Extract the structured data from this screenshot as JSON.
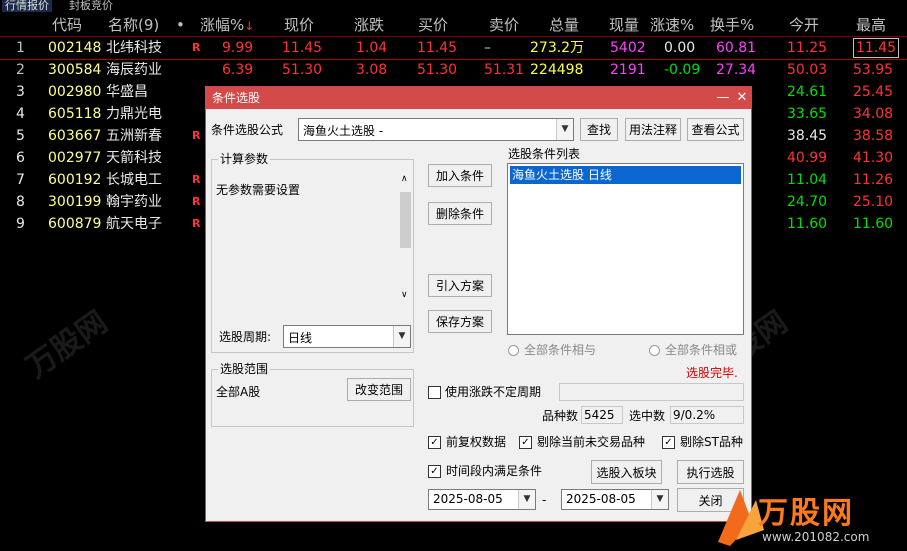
{
  "tabs": [
    "行情报价",
    "封板竞价"
  ],
  "headers": {
    "idx": "",
    "code": "代码",
    "name": "名称(9)",
    "dot": "•",
    "pct": "涨幅%",
    "sort": "↓",
    "price": "现价",
    "chg": "涨跌",
    "bid": "买价",
    "ask": "卖价",
    "vol": "总量",
    "cur": "现量",
    "speed": "涨速%",
    "turn": "换手%",
    "open": "今开",
    "high": "最高"
  },
  "rows": [
    {
      "idx": "1",
      "code": "002148",
      "name": "北纬科技",
      "mark": "R",
      "pct": "9.99",
      "price": "11.45",
      "chg": "1.04",
      "bid": "11.45",
      "ask": "–",
      "vol": "273.2万",
      "cur": "5402",
      "speed": "0.00",
      "turn": "60.81",
      "open": "11.25",
      "high": "11.45"
    },
    {
      "idx": "2",
      "code": "300584",
      "name": "海辰药业",
      "mark": "",
      "pct": "6.39",
      "price": "51.30",
      "chg": "3.08",
      "bid": "51.30",
      "ask": "51.31",
      "vol": "224498",
      "cur": "2191",
      "speed": "-0.09",
      "turn": "27.34",
      "open": "50.03",
      "high": "53.95"
    },
    {
      "idx": "3",
      "code": "002980",
      "name": "华盛昌",
      "mark": "",
      "pct": "",
      "price": "",
      "chg": "",
      "bid": "",
      "ask": "",
      "vol": "",
      "cur": "",
      "speed": "",
      "turn": "",
      "open": "24.61",
      "high": "25.45"
    },
    {
      "idx": "4",
      "code": "605118",
      "name": "力鼎光电",
      "mark": "",
      "pct": "",
      "price": "",
      "chg": "",
      "bid": "",
      "ask": "",
      "vol": "",
      "cur": "",
      "speed": "",
      "turn": "",
      "open": "33.65",
      "high": "34.08"
    },
    {
      "idx": "5",
      "code": "603667",
      "name": "五洲新春",
      "mark": "R",
      "pct": "",
      "price": "",
      "chg": "",
      "bid": "",
      "ask": "",
      "vol": "",
      "cur": "",
      "speed": "",
      "turn": "",
      "open": "38.45",
      "high": "38.58"
    },
    {
      "idx": "6",
      "code": "002977",
      "name": "天箭科技",
      "mark": "",
      "pct": "",
      "price": "",
      "chg": "",
      "bid": "",
      "ask": "",
      "vol": "",
      "cur": "",
      "speed": "",
      "turn": "",
      "open": "40.99",
      "high": "41.30"
    },
    {
      "idx": "7",
      "code": "600192",
      "name": "长城电工",
      "mark": "R",
      "pct": "",
      "price": "",
      "chg": "",
      "bid": "",
      "ask": "",
      "vol": "",
      "cur": "",
      "speed": "",
      "turn": "",
      "open": "11.04",
      "high": "11.26"
    },
    {
      "idx": "8",
      "code": "300199",
      "name": "翰宇药业",
      "mark": "R",
      "pct": "",
      "price": "",
      "chg": "",
      "bid": "",
      "ask": "",
      "vol": "",
      "cur": "",
      "speed": "",
      "turn": "",
      "open": "24.70",
      "high": "25.10"
    },
    {
      "idx": "9",
      "code": "600879",
      "name": "航天电子",
      "mark": "R",
      "pct": "",
      "price": "",
      "chg": "",
      "bid": "",
      "ask": "",
      "vol": "",
      "cur": "",
      "speed": "",
      "turn": "",
      "open": "11.60",
      "high": "11.60"
    }
  ],
  "row_colors": [
    {
      "idx": "#c0c0c0",
      "pct": "#ff3232",
      "price": "#ff3232",
      "chg": "#ff3232",
      "bid": "#ff3232",
      "ask": "#c0c0c0",
      "vol": "#ffff40",
      "cur": "#ff40ff",
      "speed": "#e8e8e8",
      "turn": "#ff40ff",
      "open": "#ff3232",
      "high": "#ff3232"
    },
    {
      "idx": "#c0c0c0",
      "pct": "#ff3232",
      "price": "#ff3232",
      "chg": "#ff3232",
      "bid": "#ff3232",
      "ask": "#ff3232",
      "vol": "#ffff40",
      "cur": "#ff40ff",
      "speed": "#00e000",
      "turn": "#ff40ff",
      "open": "#ff3232",
      "high": "#ff3232"
    },
    {
      "open": "#00e000",
      "high": "#ff3232"
    },
    {
      "open": "#00e000",
      "high": "#ff3232"
    },
    {
      "open": "#e8e8e8",
      "high": "#ff3232"
    },
    {
      "open": "#ff3232",
      "high": "#ff3232"
    },
    {
      "open": "#00e000",
      "high": "#ff3232"
    },
    {
      "open": "#00e000",
      "high": "#ff3232"
    },
    {
      "open": "#00e000",
      "high": "#00e000"
    }
  ],
  "dialog": {
    "title": "条件选股",
    "minimize": "—",
    "close": "✕",
    "formula_label": "条件选股公式",
    "formula_value": "海鱼火土选股  -",
    "find_btn": "查找",
    "usage_btn": "用法注释",
    "view_btn": "查看公式",
    "params_title": "计算参数",
    "params_text": "无参数需要设置",
    "period_label": "选股周期:",
    "period_value": "日线",
    "add_btn": "加入条件",
    "del_btn": "删除条件",
    "import_btn": "引入方案",
    "save_btn": "保存方案",
    "list_title": "选股条件列表",
    "list_items": [
      "海鱼火土选股  日线"
    ],
    "radio_and": "全部条件相与",
    "radio_or": "全部条件相或",
    "status": "选股完毕.",
    "scope_title": "选股范围",
    "scope_value": "全部A股",
    "change_scope_btn": "改变范围",
    "uncertain_label": "使用涨跌不定周期",
    "count_label": "品种数",
    "count_value": "5425",
    "hit_label": "选中数",
    "hit_value": "9/0.2%",
    "pre_adjust_label": "前复权数据",
    "exclude_untraded_label": "剔除当前未交易品种",
    "exclude_st_label": "剔除ST品种",
    "time_range_label": "时间段内满足条件",
    "to_block_btn": "选股入板块",
    "run_btn": "执行选股",
    "date_from": "2025-08-05",
    "date_sep": "-",
    "date_to": "2025-08-05",
    "close_btn": "关闭",
    "check_mark": "✓",
    "arrow_down": "▼",
    "scroll_up": "∧",
    "scroll_down": "∨"
  },
  "watermark": {
    "text": "万股网",
    "site": "www.201082.com"
  },
  "colors": {
    "accent_title": "#d24a4a",
    "selection": "#0b66d0",
    "up": "#ff3232",
    "down": "#00e000"
  }
}
